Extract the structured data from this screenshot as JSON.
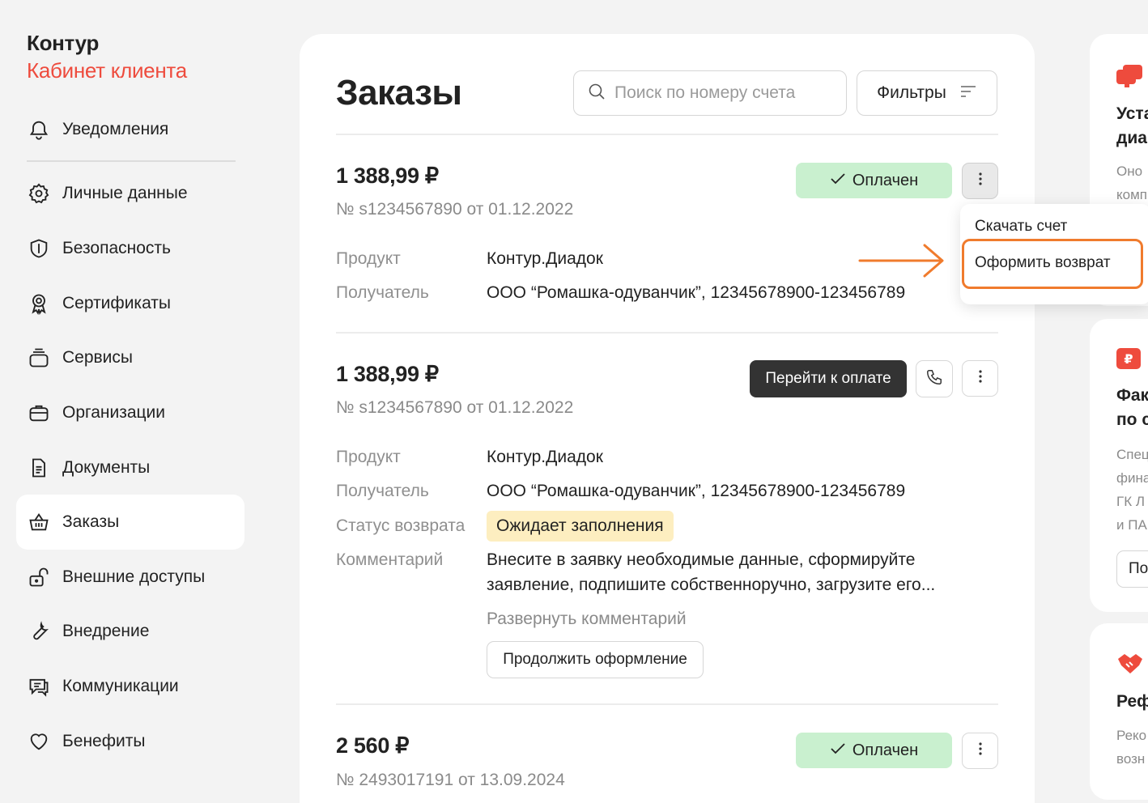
{
  "brand": {
    "title": "Контур",
    "subtitle": "Кабинет клиента"
  },
  "sidebar": {
    "items": [
      {
        "label": "Уведомления",
        "icon": "bell-icon"
      },
      {
        "label": "Личные данные",
        "icon": "gear-icon"
      },
      {
        "label": "Безопасность",
        "icon": "shield-icon"
      },
      {
        "label": "Сертификаты",
        "icon": "certificate-icon"
      },
      {
        "label": "Сервисы",
        "icon": "services-icon"
      },
      {
        "label": "Организации",
        "icon": "briefcase-icon"
      },
      {
        "label": "Документы",
        "icon": "document-icon"
      },
      {
        "label": "Заказы",
        "icon": "basket-icon",
        "active": true
      },
      {
        "label": "Внешние доступы",
        "icon": "unlock-icon"
      },
      {
        "label": "Внедрение",
        "icon": "wrench-icon"
      },
      {
        "label": "Коммуникации",
        "icon": "chat-icon"
      },
      {
        "label": "Бенефиты",
        "icon": "heart-icon"
      }
    ]
  },
  "main": {
    "title": "Заказы",
    "search_placeholder": "Поиск по номеру счета",
    "filters_label": "Фильтры",
    "orders": [
      {
        "amount": "1 388,99 ₽",
        "number": "№ s1234567890 от 01.12.2022",
        "status": "Оплачен",
        "product_label": "Продукт",
        "product": "Контур.Диадок",
        "recipient_label": "Получатель",
        "recipient": "ООО “Ромашка-одуванчик”, 12345678900-123456789"
      },
      {
        "amount": "1 388,99 ₽",
        "number": "№ s1234567890 от 01.12.2022",
        "pay_label": "Перейти к оплате",
        "product_label": "Продукт",
        "product": "Контур.Диадок",
        "recipient_label": "Получатель",
        "recipient": "ООО “Ромашка-одуванчик”, 12345678900-123456789",
        "return_status_label": "Статус возврата",
        "return_status": "Ожидает заполнения",
        "comment_label": "Комментарий",
        "comment_line1": "Внесите в заявку необходимые данные, сформируйте",
        "comment_line2": "заявление, подпишите собственноручно, загрузите его...",
        "expand_label": "Развернуть комментарий",
        "continue_label": "Продолжить оформление"
      },
      {
        "amount": "2 560 ₽",
        "number": "№ 2493017191 от 13.09.2024",
        "status": "Оплачен"
      }
    ]
  },
  "dropdown": {
    "items": [
      "Скачать счет",
      "Оформить возврат"
    ]
  },
  "promos": [
    {
      "title_line1": "Уста",
      "title_line2": "диа",
      "text_line1": "Оно",
      "text_line2": "комп"
    },
    {
      "title_line1": "Фак",
      "title_line2": "по с",
      "text_line1": "Спец",
      "text_line2": "фина",
      "text_line3": "ГК Л",
      "text_line4": "и ПА",
      "button": "По"
    },
    {
      "title_line1": "Реф",
      "text_line1": "Реко",
      "text_line2": "возн"
    }
  ],
  "colors": {
    "brand_red": "#ee4b3d",
    "paid_green": "#c9f0cf",
    "warn_yellow": "#fdeec0",
    "highlight_orange": "#f07b2d"
  }
}
